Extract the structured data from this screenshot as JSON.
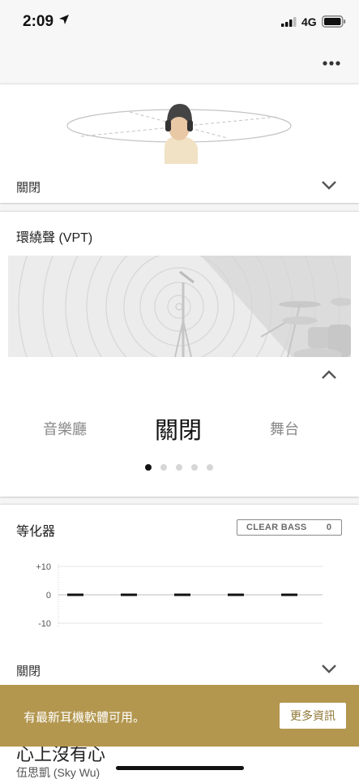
{
  "status_bar": {
    "time": "2:09",
    "network": "4G",
    "icons": [
      "location-arrow-icon",
      "signal-bars-icon",
      "battery-icon"
    ]
  },
  "nav": {
    "more_icon": "ellipsis-icon"
  },
  "sound_position": {
    "value": "關閉",
    "chevron": "chevron-down-icon"
  },
  "surround": {
    "title": "環繞聲 (VPT)",
    "chevron": "chevron-up-icon",
    "presets": [
      "音樂廳",
      "關閉",
      "舞台"
    ],
    "selected_preset": "關閉",
    "page_count": 5,
    "active_page": 0
  },
  "equalizer": {
    "title": "等化器",
    "clear_bass_label": "CLEAR BASS",
    "clear_bass_value": "0",
    "axis_labels": [
      "+10",
      "0",
      "-10"
    ],
    "band_values": [
      0,
      0,
      0,
      0,
      0
    ],
    "value": "關閉",
    "chevron": "chevron-down-icon"
  },
  "update_banner": {
    "message": "有最新耳機軟體可用。",
    "button_label": "更多資訊",
    "background_color": "#b3974f"
  },
  "now_playing": {
    "title": "心上沒有心",
    "artist": "伍思凱 (Sky Wu)"
  }
}
